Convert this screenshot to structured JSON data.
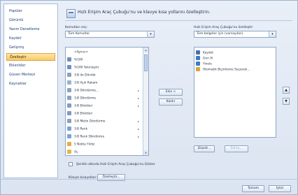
{
  "nav": {
    "items": [
      {
        "label": "Popüler",
        "active": false
      },
      {
        "label": "Görüntü",
        "active": false
      },
      {
        "label": "Yazım Denetleme",
        "active": false
      },
      {
        "label": "Kaydet",
        "active": false
      },
      {
        "label": "Gelişmiş",
        "active": false
      },
      {
        "label": "Özelleştir",
        "active": true
      },
      {
        "label": "Eklentiler",
        "active": false
      },
      {
        "label": "Güven Merkezi",
        "active": false
      },
      {
        "label": "Kaynaklar",
        "active": false
      }
    ]
  },
  "header": {
    "title": "Hızlı Erişim Araç Çubuğu'nu ve klavye kısa yollarını özelleştirin."
  },
  "left_panel": {
    "label": "Komutları seç:",
    "dropdown_value": "Tüm Komutlar",
    "commands": [
      {
        "label": "<Ayırıcı>",
        "icon": "separator-icon",
        "sub": ""
      },
      {
        "label": "%100",
        "icon": "zoom-icon",
        "sub": ""
      },
      {
        "label": "%100 Yakınlaştır",
        "icon": "zoom-icon",
        "sub": ""
      },
      {
        "label": "3-B de Döndür",
        "icon": "3d-rotate-icon",
        "sub": ""
      },
      {
        "label": "3-B Açık Rakam",
        "icon": "3d-icon",
        "sub": ""
      },
      {
        "label": "3-B Döndürme...",
        "icon": "3d-rotate-icon",
        "sub": "▸"
      },
      {
        "label": "3-B Döndürme",
        "icon": "3d-rotate-icon",
        "sub": "▸"
      },
      {
        "label": "3-B Efektleri",
        "icon": "3d-effects-icon",
        "sub": "▸"
      },
      {
        "label": "3-B Efektleri",
        "icon": "3d-effects-icon",
        "sub": ""
      },
      {
        "label": "3-B Metin Döndürme",
        "icon": "3d-rotate-icon",
        "sub": "▸"
      },
      {
        "label": "3-B Renk",
        "icon": "color-icon",
        "sub": "▸"
      },
      {
        "label": "3-B Renk Döndürme",
        "icon": "color-icon",
        "sub": "▸"
      },
      {
        "label": "5 Nokta Yıldız",
        "icon": "star-icon",
        "sub": ""
      },
      {
        "label": "Aç",
        "icon": "open-folder-icon",
        "sub": ""
      }
    ]
  },
  "right_panel": {
    "label": "Hızlı Erişim Araç Çubuğu'nu özelleştir:",
    "dropdown_value": "Tüm belgeler için (varsayılan)",
    "commands": [
      {
        "label": "Kaydet",
        "icon": "save-icon"
      },
      {
        "label": "Geri Al",
        "icon": "undo-icon"
      },
      {
        "label": "Yinele",
        "icon": "redo-icon"
      },
      {
        "label": "Otomatik Biçimleme Seçenek...",
        "icon": "autoformat-icon"
      }
    ]
  },
  "buttons": {
    "add": "Ekle >",
    "remove": "Kaldır",
    "edit": "Düzelt...",
    "reset": "Sıfırla...",
    "customize": "Özelleştir...",
    "ok": "Tamam",
    "cancel": "İptal",
    "move_up": "▲",
    "move_down": "▼"
  },
  "footer": {
    "checkbox_label": "Şeridin altında Hızlı Erişim Araç Çubuğu'nu Göster",
    "shortcuts_label": "Klavye kısayolları:"
  },
  "colors": {
    "accent_active": "#f8c96a",
    "selection": "#cde1f9"
  }
}
